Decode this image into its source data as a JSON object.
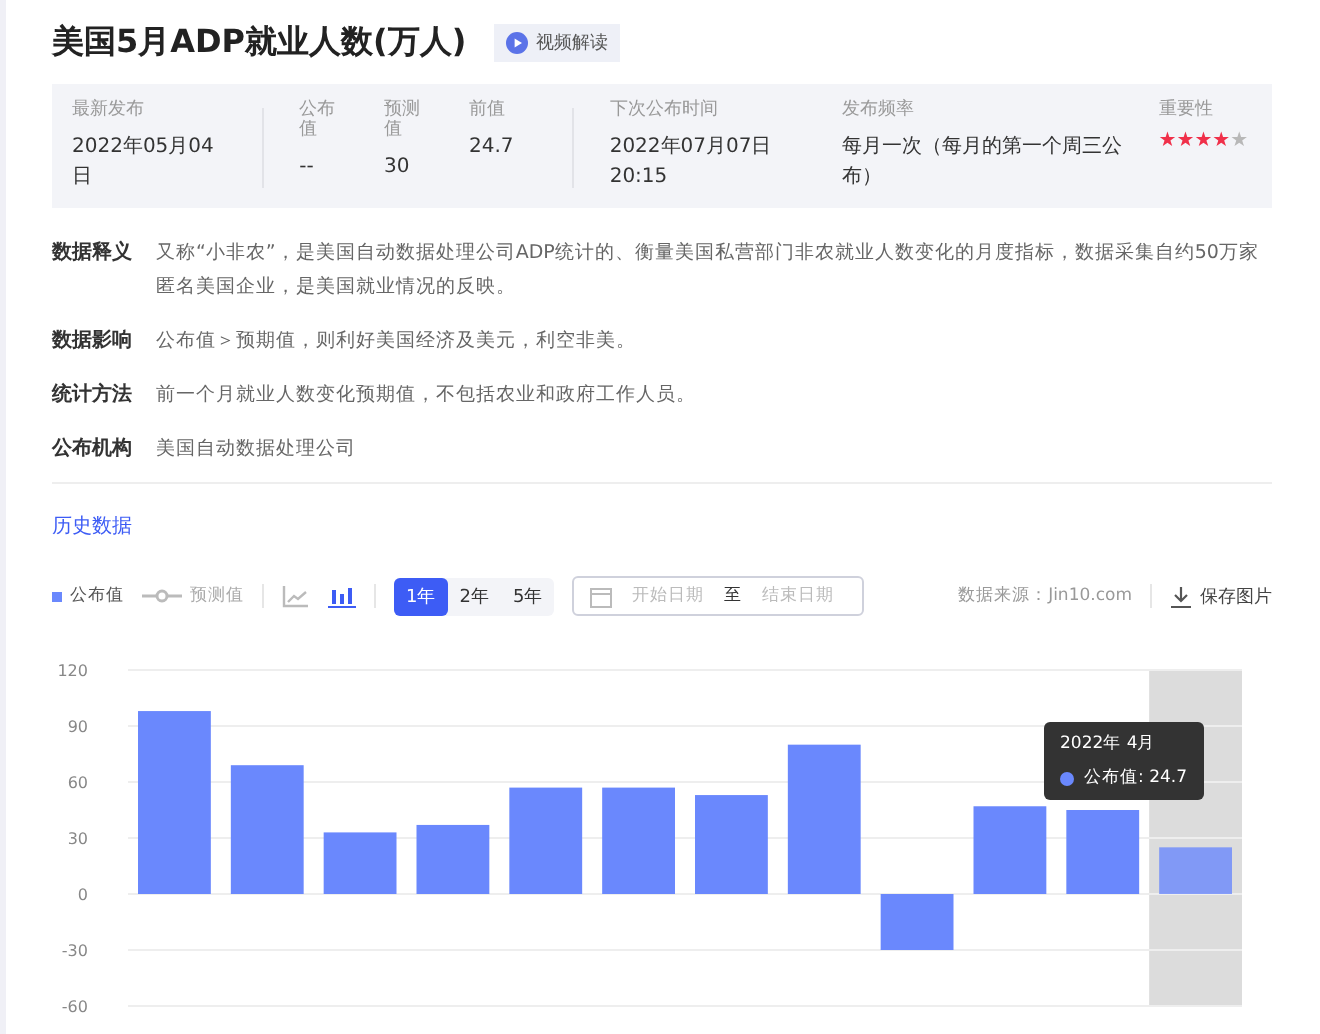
{
  "title": "美国5月ADP就业人数(万人)",
  "video_button": {
    "label": "视频解读"
  },
  "info": [
    {
      "kind": "text",
      "label": "最新发布",
      "value": "2022年05月04日"
    },
    {
      "kind": "text",
      "label": "公布值",
      "value": "--"
    },
    {
      "kind": "text",
      "label": "预测值",
      "value": "30"
    },
    {
      "kind": "text",
      "label": "前值",
      "value": "24.7"
    },
    {
      "kind": "text",
      "label": "下次公布时间",
      "value": "2022年07月07日 20:15"
    },
    {
      "kind": "text",
      "label": "发布频率",
      "value": "每月一次（每月的第一个周三公布）"
    },
    {
      "kind": "stars",
      "label": "重要性",
      "stars": 4
    }
  ],
  "details": [
    {
      "label": "数据释义",
      "text": "又称“小非农”，是美国自动数据处理公司ADP统计的、衡量美国私营部门非农就业人数变化的月度指标，数据采集自约50万家匿名美国企业，是美国就业情况的反映。"
    },
    {
      "label": "数据影响",
      "text": "公布值＞预期值，则利好美国经济及美元，利空非美。"
    },
    {
      "label": "统计方法",
      "text": "前一个月就业人数变化预期值，不包括农业和政府工作人员。"
    },
    {
      "label": "公布机构",
      "text": "美国自动数据处理公司"
    }
  ],
  "history": {
    "title": "历史数据",
    "legend": [
      {
        "kind": "line",
        "label": "预测值"
      }
    ],
    "chart_types": [
      {
        "kind": "line",
        "selected": false
      },
      {
        "kind": "bar",
        "selected": true
      }
    ],
    "ranges": [
      {
        "label": "1年",
        "selected": true
      },
      {
        "label": "2年",
        "selected": false
      },
      {
        "label": "5年",
        "selected": false
      }
    ],
    "date_range": {
      "start_placeholder": "开始日期",
      "separator": "至",
      "end_placeholder": "结束日期"
    },
    "source": "数据来源：Jin10.com",
    "save_button": {
      "label": "保存图片"
    },
    "tooltip": {
      "title": "2022年 4月",
      "label": "公布值: 24.7"
    },
    "chart_data": {
      "type": "bar",
      "grid": true,
      "ylim": [
        -60,
        120
      ],
      "yticks": [
        -60,
        -30,
        0,
        30,
        60,
        90,
        120
      ],
      "series": [
        {
          "name": "公布值",
          "color": "#6a88fd",
          "values": [
            98,
            69,
            33,
            37,
            57,
            57,
            53,
            80,
            -30,
            47,
            45,
            25
          ]
        }
      ]
    }
  }
}
